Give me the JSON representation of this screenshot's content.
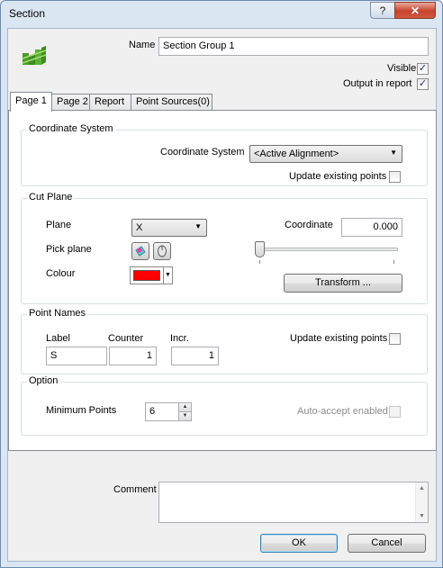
{
  "window": {
    "title": "Section",
    "help_label": "?",
    "close_label": "✕"
  },
  "header": {
    "name_label": "Name",
    "name_value": "Section Group 1",
    "visible_label": "Visible",
    "visible_checked": "✓",
    "output_label": "Output in report",
    "output_checked": "✓"
  },
  "tabs": [
    {
      "label": "Page 1"
    },
    {
      "label": "Page 2"
    },
    {
      "label": "Report"
    },
    {
      "label": "Point Sources(0)"
    }
  ],
  "coordinate_system": {
    "title": "Coordinate System",
    "label": "Coordinate System",
    "value": "<Active Alignment>",
    "update_label": "Update existing points"
  },
  "cut_plane": {
    "title": "Cut Plane",
    "plane_label": "Plane",
    "plane_value": "X",
    "pick_label": "Pick plane",
    "colour_label": "Colour",
    "colour_value": "#ff0000",
    "coordinate_label": "Coordinate",
    "coordinate_value": "0.000",
    "slider_level": 0,
    "transform_label": "Transform ..."
  },
  "point_names": {
    "title": "Point Names",
    "label_header": "Label",
    "counter_header": "Counter",
    "incr_header": "Incr.",
    "label_value": "S",
    "counter_value": "1",
    "incr_value": "1",
    "update_label": "Update existing points"
  },
  "option": {
    "title": "Option",
    "min_points_label": "Minimum Points",
    "min_points_value": "6",
    "auto_accept_label": "Auto-accept enabled"
  },
  "footer": {
    "comment_label": "Comment",
    "comment_value": "",
    "ok_label": "OK",
    "cancel_label": "Cancel"
  }
}
